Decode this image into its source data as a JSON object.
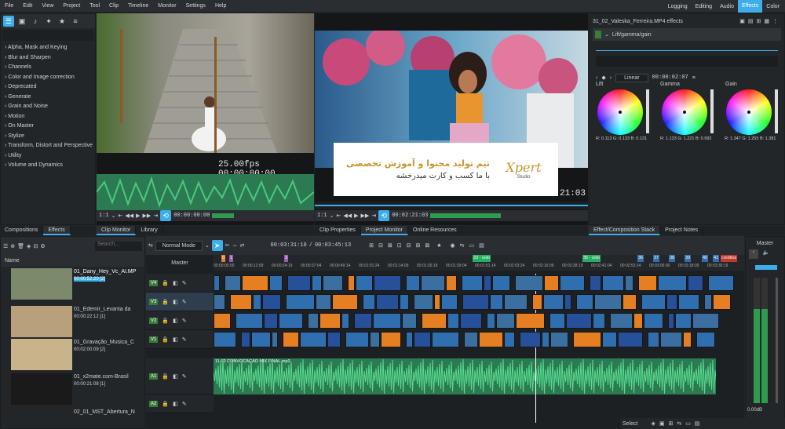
{
  "menu": [
    "File",
    "Edit",
    "View",
    "Project",
    "Tool",
    "Clip",
    "Timeline",
    "Monitor",
    "Settings",
    "Help"
  ],
  "workspaces": [
    "Logging",
    "Editing",
    "Audio",
    "Effects",
    "Color"
  ],
  "active_workspace": "Effects",
  "effects_categories": [
    "Alpha, Mask and Keying",
    "Blur and Sharpen",
    "Channels",
    "Color and Image correction",
    "Deprecated",
    "Generate",
    "Grain and Noise",
    "Motion",
    "On Master",
    "Stylize",
    "Transform, Distort and Perspective",
    "Utility",
    "Volume and Dynamics"
  ],
  "left_tabs": [
    "Compositions",
    "Effects"
  ],
  "monitor_tabs": [
    "Clip Monitor",
    "Library"
  ],
  "project_tabs": [
    "Clip Properties",
    "Project Monitor",
    "Online Resources"
  ],
  "right_tabs": [
    "Effect/Composition Stack",
    "Project Notes"
  ],
  "clip_monitor": {
    "fps": "25.00fps",
    "timecode": "00:00:00:00",
    "zoom": "1:1",
    "position": "00:00:00:00"
  },
  "project_monitor": {
    "timecode_partial": "21:03",
    "zoom": "1:1",
    "position": "00:02:21:03"
  },
  "overlay": {
    "line1": "تیم تولید محتوا و آموزش تخصصی",
    "line2": "با ما کسب و کارت میدرخشه",
    "logo": "Xpert",
    "logo_sub": "Studio"
  },
  "effects_panel": {
    "title": "31_02_Valeska_Ferreira.MP4 effects",
    "effect_name": "Lift/gamma/gain",
    "interp": "Linear",
    "timecode": "00:00:02:07",
    "wheels": [
      {
        "label": "Lift",
        "values": "R: 0.113  G: 0.133  B: 0.131"
      },
      {
        "label": "Gamma",
        "values": "R: 1.133  G: 1.221  B: 0.992"
      },
      {
        "label": "Gain",
        "values": "R: 1.347  G: 1.255  B: 1.381"
      }
    ]
  },
  "bin": {
    "header": "Name",
    "search_placeholder": "Search...",
    "items": [
      {
        "name": "01_Dany_Hey_Vc_AI.MP",
        "dur": "00:00:52:20 [2]"
      },
      {
        "name": "01_Edemir_Levanta da",
        "dur": "00:00:22:12 [1]"
      },
      {
        "name": "01_Gravação_Musica_C",
        "dur": "00:02:00:09 [2]"
      },
      {
        "name": "01_x2mate.com-Brasil",
        "dur": "00:00:21:08 [1]"
      },
      {
        "name": "02_01_MST_Abertura_N",
        "dur": ""
      }
    ]
  },
  "timeline": {
    "mode": "Normal Mode",
    "position": "00:03:31:10",
    "duration": "00:03:45:13",
    "master": "Master",
    "ruler": [
      "00:00:00:00",
      "00:00:12:09",
      "00:00:24:19",
      "00:00:37:04",
      "00:00:49:14",
      "00:01:01:24",
      "00:01:14:09",
      "00:01:26:19",
      "00:01:39:04",
      "00:01:51:14",
      "00:02:03:24",
      "00:02:16:09",
      "00:02:28:19",
      "00:02:41:04",
      "00:02:53:14",
      "00:03:06:00",
      "00:03:18:09",
      "00:03:30:19"
    ],
    "tracks": [
      "V4",
      "V3",
      "V2",
      "V1",
      "A1",
      "A2"
    ],
    "audio_clip": "11-02 CONVOCAÇAO MIX FINAL.mp3",
    "markers": [
      "0",
      "1",
      "3",
      "23 - solo",
      "35 - solo",
      "36",
      "37",
      "38",
      "39",
      "40",
      "41",
      "creditos"
    ]
  },
  "mixer": {
    "title": "Master",
    "level": "0.00dB",
    "scale": [
      "-2",
      "-5",
      "-10",
      "-15",
      "-20",
      "-25",
      "-30",
      "-40",
      "-50"
    ]
  },
  "status": {
    "select": "Select"
  },
  "colors": {
    "accent": "#3daee9",
    "video_clip": "#2f6fb0",
    "audio_clip": "#2c7a52",
    "orange": "#e67e22"
  }
}
